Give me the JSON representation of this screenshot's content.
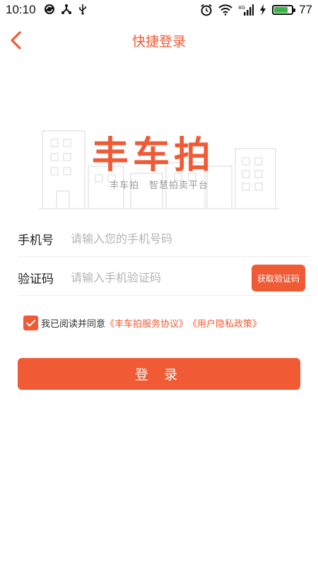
{
  "status_bar": {
    "time": "10:10",
    "battery_level": "77",
    "battery_fill": 0.77,
    "icons_left": [
      "sync-icon",
      "share-icon",
      "usb-icon"
    ],
    "icons_right": [
      "alarm-icon",
      "wifi-icon",
      "signal-4g-icon",
      "charging-icon",
      "battery-icon"
    ]
  },
  "nav": {
    "title": "快捷登录",
    "back_icon": "chevron-left-icon"
  },
  "logo": {
    "brand": "丰车拍",
    "slogan_name": "丰车拍",
    "slogan_text": "智慧拍卖平台"
  },
  "form": {
    "phone_label": "手机号",
    "phone_placeholder": "请输入您的手机号码",
    "phone_value": "",
    "code_label": "验证码",
    "code_placeholder": "请输入手机验证码",
    "code_value": "",
    "get_code_label": "获取验证码"
  },
  "agreement": {
    "checked": true,
    "prefix": "我已阅读并同意",
    "service_link": "《丰车拍服务协议》",
    "privacy_link": "《用户隐私政策》"
  },
  "login_label": "登 录",
  "colors": {
    "accent": "#f05a35",
    "battery": "#3cb34a",
    "placeholder": "#b5b5b5"
  }
}
